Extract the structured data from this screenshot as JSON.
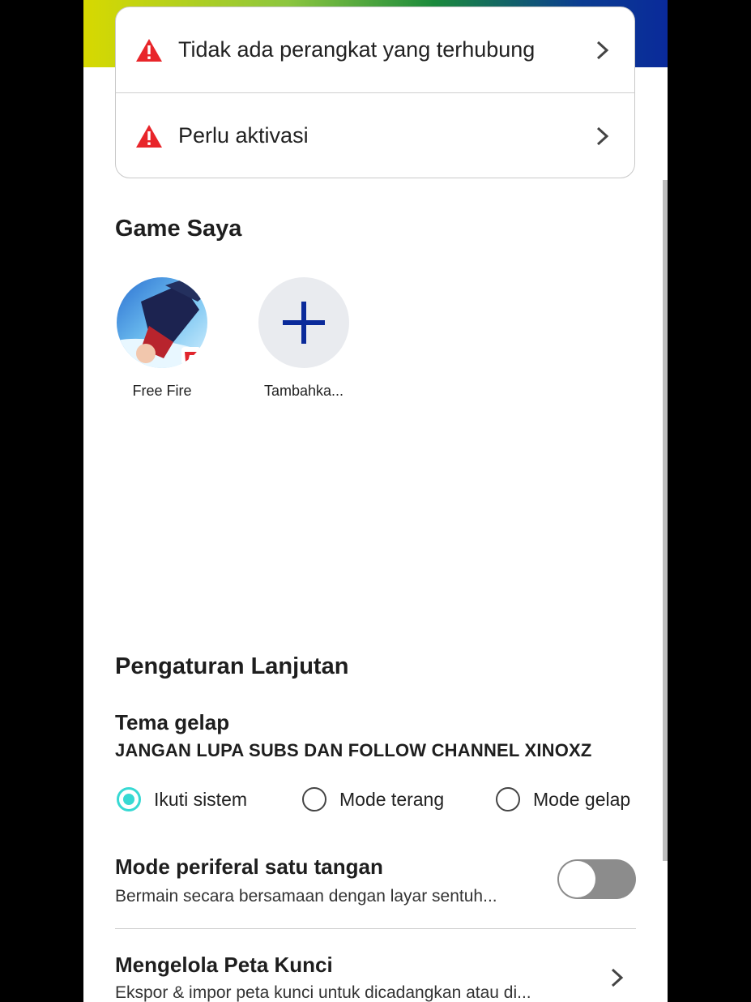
{
  "status": {
    "items": [
      {
        "label": "Tidak ada perangkat yang terhubung",
        "icon": "warning-icon"
      },
      {
        "label": "Perlu aktivasi",
        "icon": "warning-icon"
      }
    ]
  },
  "games": {
    "title": "Game Saya",
    "items": [
      {
        "label": "Free Fire"
      },
      {
        "label": "Tambahka..."
      }
    ]
  },
  "advanced": {
    "title": "Pengaturan Lanjutan",
    "dark_theme": {
      "title": "Tema gelap",
      "note": "JANGAN LUPA SUBS DAN FOLLOW CHANNEL XINOXZ",
      "options": [
        "Ikuti sistem",
        "Mode terang",
        "Mode gelap"
      ],
      "selected": "Ikuti sistem"
    },
    "one_hand": {
      "title": "Mode periferal satu tangan",
      "subtitle": "Bermain secara bersamaan dengan layar sentuh...",
      "enabled": false
    },
    "keymap": {
      "title": "Mengelola Peta Kunci",
      "subtitle": "Ekspor & impor peta kunci untuk dicadangkan atau di..."
    }
  },
  "colors": {
    "accent": "#37d9d3",
    "warning": "#e8252a",
    "add_icon": "#0a2a9a"
  }
}
